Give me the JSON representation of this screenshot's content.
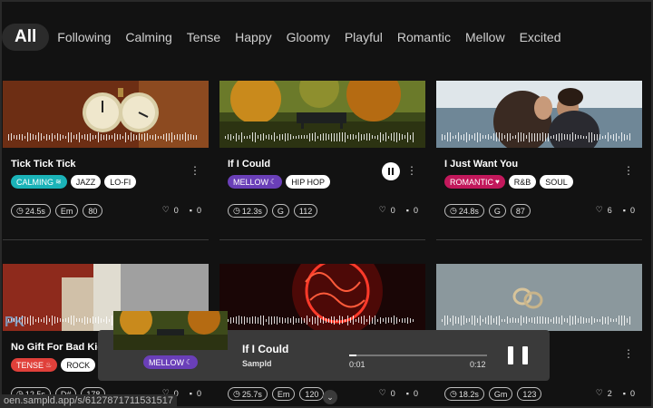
{
  "filters": [
    "All",
    "Following",
    "Calming",
    "Tense",
    "Happy",
    "Gloomy",
    "Playful",
    "Romantic",
    "Mellow",
    "Excited"
  ],
  "colors": {
    "calming": "#1bb3b8",
    "mellow": "#6a3fb8",
    "romantic": "#c2185b",
    "tense": "#e0403a"
  },
  "cards": [
    {
      "title": "Tick Tick Tick",
      "mood": "CALMING",
      "mood_icon": "waves-icon",
      "genres": [
        "JAZZ",
        "LO-FI"
      ],
      "duration": "24.5s",
      "key": "Em",
      "bpm": "80",
      "likes": "0",
      "comments": "0"
    },
    {
      "title": "If I Could",
      "mood": "MELLOW",
      "mood_icon": "moon-icon",
      "genres": [
        "HIP HOP"
      ],
      "duration": "12.3s",
      "key": "G",
      "bpm": "112",
      "likes": "0",
      "comments": "0"
    },
    {
      "title": "I Just Want You",
      "mood": "ROMANTIC",
      "mood_icon": "heart-icon",
      "genres": [
        "R&B",
        "SOUL"
      ],
      "duration": "24.8s",
      "key": "G",
      "bpm": "87",
      "likes": "6",
      "comments": "0"
    },
    {
      "title": "No Gift For Bad Kids",
      "mood": "TENSE",
      "mood_icon": "fire-icon",
      "genres": [
        "ROCK"
      ],
      "duration": "12.5s",
      "key": "D#",
      "bpm": "178",
      "likes": "0",
      "comments": "0"
    },
    {
      "title": "",
      "duration": "25.7s",
      "key": "Em",
      "bpm": "120",
      "likes": "0",
      "comments": "0"
    },
    {
      "title": "",
      "duration": "18.2s",
      "key": "Gm",
      "bpm": "123",
      "likes": "2",
      "comments": "0"
    }
  ],
  "player": {
    "title": "If I Could",
    "artist": "Sampld",
    "mood": "MELLOW",
    "current_time": "0:01",
    "total_time": "0:12",
    "progress": 0.05
  },
  "watermark": "PK",
  "status_url": "oen.sampld.app/s/6127871711531517"
}
